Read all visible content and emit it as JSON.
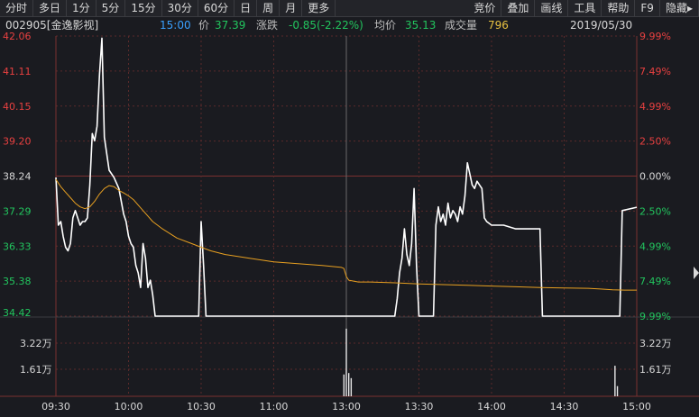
{
  "toolbar": {
    "left": [
      "分时",
      "多日",
      "1分",
      "5分",
      "15分",
      "30分",
      "60分",
      "日",
      "周",
      "月",
      "更多"
    ],
    "right": [
      "竞价",
      "叠加",
      "画线",
      "工具",
      "帮助",
      "F9",
      "隐藏"
    ]
  },
  "info": {
    "code_name": "002905[金逸影视]",
    "time": "15:00",
    "price_label": "价",
    "price": "37.39",
    "change_label": "涨跌",
    "change": "-0.85(-2.22%)",
    "avg_label": "均价",
    "avg": "35.13",
    "volume_label": "成交量",
    "volume": "796",
    "date": "2019/05/30"
  },
  "colors": {
    "background": "#1a1b20",
    "price_line": "#ffffff",
    "avg_line": "#e8a020",
    "up": "#e84040",
    "down": "#22c55e",
    "neutral": "#d8d8d8",
    "grid": "#5a2a2a",
    "volume": "#e8e8e8"
  },
  "chart_data": {
    "type": "line",
    "title": "",
    "prev_close": 38.24,
    "price_axis": {
      "ticks": [
        "42.06",
        "41.11",
        "40.15",
        "39.20",
        "38.24",
        "37.29",
        "36.33",
        "35.38",
        "34.42"
      ],
      "ylim": [
        34.42,
        42.06
      ]
    },
    "pct_axis": {
      "ticks": [
        "9.99%",
        "7.49%",
        "4.99%",
        "2.50%",
        "0.00%",
        "2.50%",
        "4.99%",
        "7.49%",
        "9.99%"
      ]
    },
    "volume_axis": {
      "ticks": [
        "3.22万",
        "1.61万"
      ],
      "ylim": [
        0,
        48300
      ]
    },
    "time_axis": {
      "ticks": [
        "09:30",
        "10:00",
        "10:30",
        "11:00",
        "13:00",
        "13:30",
        "14:00",
        "14:30",
        "15:00"
      ],
      "minutes": [
        0,
        30,
        60,
        90,
        120,
        150,
        180,
        210,
        240
      ]
    },
    "series": [
      {
        "name": "价",
        "x": [
          0,
          1,
          2,
          3,
          4,
          5,
          6,
          7,
          8,
          10,
          11,
          12,
          13,
          14,
          15,
          16,
          17,
          18,
          19,
          20,
          22,
          24,
          26,
          28,
          29,
          30,
          31,
          32,
          33,
          34,
          35,
          36,
          37,
          38,
          39,
          40,
          41,
          42,
          43,
          44,
          45,
          46,
          47,
          48,
          49,
          50,
          51,
          52,
          53,
          54,
          55,
          57,
          58,
          59,
          60,
          61,
          62,
          63,
          64,
          65,
          66,
          67,
          68,
          70,
          80,
          90,
          100,
          110,
          119,
          120,
          121,
          130,
          140,
          141,
          142,
          143,
          144,
          145,
          146,
          147,
          148,
          149,
          150,
          151,
          152,
          153,
          154,
          156,
          157,
          158,
          159,
          160,
          161,
          162,
          163,
          164,
          165,
          166,
          167,
          168,
          169,
          170,
          171,
          172,
          173,
          174,
          175,
          176,
          177,
          178,
          180,
          182,
          185,
          190,
          200,
          201,
          202,
          210,
          220,
          230,
          232,
          233,
          234,
          240
        ],
        "y": [
          38.2,
          36.9,
          37.0,
          36.6,
          36.3,
          36.2,
          36.4,
          37.1,
          37.3,
          36.9,
          37.0,
          37.0,
          37.1,
          38.0,
          39.4,
          39.2,
          39.6,
          41.0,
          42.0,
          39.3,
          38.4,
          38.2,
          37.9,
          37.2,
          37.0,
          36.6,
          36.4,
          36.3,
          35.8,
          35.6,
          35.2,
          36.4,
          36.0,
          35.2,
          35.4,
          35.0,
          34.42,
          34.42,
          34.42,
          34.42,
          34.42,
          34.42,
          34.42,
          34.42,
          34.42,
          34.42,
          34.42,
          34.42,
          34.42,
          34.42,
          34.42,
          34.42,
          34.42,
          34.42,
          37.0,
          35.8,
          34.42,
          34.42,
          34.42,
          34.42,
          34.42,
          34.42,
          34.42,
          34.42,
          34.42,
          34.42,
          34.42,
          34.42,
          34.42,
          34.42,
          34.42,
          34.42,
          34.42,
          34.9,
          35.6,
          36.0,
          36.8,
          36.1,
          35.8,
          36.4,
          37.9,
          35.8,
          34.42,
          34.42,
          34.42,
          34.42,
          34.42,
          34.42,
          36.9,
          37.4,
          37.0,
          37.2,
          36.9,
          37.5,
          37.1,
          37.3,
          37.2,
          37.0,
          37.4,
          37.2,
          37.7,
          38.6,
          38.3,
          38.0,
          37.9,
          38.1,
          38.0,
          37.9,
          37.1,
          37.0,
          36.9,
          36.9,
          36.9,
          36.8,
          36.8,
          34.42,
          34.42,
          34.42,
          34.42,
          34.42,
          34.42,
          34.42,
          37.3,
          37.39
        ]
      },
      {
        "name": "均价",
        "x": [
          0,
          2,
          4,
          6,
          8,
          10,
          12,
          14,
          16,
          18,
          20,
          22,
          24,
          26,
          28,
          30,
          32,
          34,
          36,
          38,
          40,
          44,
          50,
          56,
          60,
          64,
          70,
          80,
          90,
          100,
          110,
          118,
          119,
          120,
          121,
          125,
          130,
          140,
          150,
          160,
          170,
          180,
          190,
          200,
          210,
          220,
          225,
          230,
          235,
          240
        ],
        "y": [
          38.15,
          37.95,
          37.8,
          37.65,
          37.5,
          37.4,
          37.35,
          37.4,
          37.55,
          37.75,
          37.9,
          37.98,
          37.95,
          37.85,
          37.78,
          37.7,
          37.6,
          37.45,
          37.3,
          37.15,
          37.0,
          36.8,
          36.55,
          36.4,
          36.3,
          36.2,
          36.1,
          36.0,
          35.9,
          35.85,
          35.8,
          35.75,
          35.72,
          35.5,
          35.4,
          35.35,
          35.35,
          35.33,
          35.3,
          35.28,
          35.26,
          35.24,
          35.22,
          35.2,
          35.19,
          35.18,
          35.16,
          35.14,
          35.13,
          35.13
        ]
      }
    ],
    "volume": {
      "x": [
        119,
        120,
        121,
        122,
        231,
        232
      ],
      "values": [
        15000,
        46500,
        16000,
        12500,
        21000,
        7000
      ]
    }
  }
}
